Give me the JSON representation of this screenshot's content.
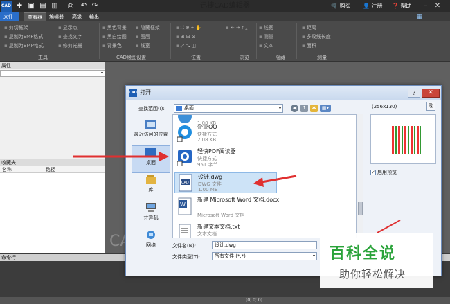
{
  "app": {
    "logo": "CAD",
    "title": "迅捷CAD编辑器",
    "top_right": {
      "buy": "购买",
      "register": "注册",
      "help": "帮助"
    }
  },
  "menu": [
    "文件",
    "查看器",
    "编辑器",
    "高级",
    "输出"
  ],
  "ribbon": {
    "tools": {
      "items": [
        "剪切框架",
        "复制为EMF格式",
        "复制为BMP格式",
        "显示点",
        "查找文字",
        "修剪光栅"
      ],
      "label": "工具"
    },
    "settings": {
      "items": [
        "黑色背景",
        "黑白绘图",
        "背景色",
        "图层",
        "线宽",
        "隐藏框架"
      ],
      "label": "CAD绘图设置"
    },
    "position": {
      "label": "位置"
    },
    "browse": {
      "label": "浏览"
    },
    "hide": {
      "items": [
        "线宽",
        "测量",
        "文本"
      ],
      "label": "隐藏"
    },
    "measure": {
      "items": [
        "距离",
        "多段线长度",
        "面积"
      ],
      "label": "测量"
    }
  },
  "panels": {
    "properties": "属性",
    "favorites": "收藏夹",
    "fav_columns": [
      "名称",
      "路径"
    ],
    "command": "命令行"
  },
  "canvas_text": "CAD",
  "status_text": "(0; 0; 0)",
  "dialog": {
    "title": "打开",
    "help": "?",
    "close": "✕",
    "look_in_label": "查找范围(I):",
    "look_in_value": "桌面",
    "places": [
      "最近访问的位置",
      "桌面",
      "库",
      "计算机",
      "网络"
    ],
    "files": [
      {
        "name": "",
        "type": "",
        "size": "1.00 KB"
      },
      {
        "name": "企业QQ",
        "type": "快捷方式",
        "size": "2.08 KB"
      },
      {
        "name": "轻快PDF阅读器",
        "type": "快捷方式",
        "size": "951 字节"
      },
      {
        "name": "设计.dwg",
        "type": "DWG 文件",
        "size": "1.00 MB"
      },
      {
        "name": "新建 Microsoft Word 文档.docx",
        "type": "Microsoft Word 文档",
        "size": ""
      },
      {
        "name": "新建文本文档.txt",
        "type": "文本文档",
        "size": ""
      }
    ],
    "filename_label": "文件名(N):",
    "filename_value": "设计.dwg",
    "filetype_label": "文件类型(T):",
    "filetype_value": "所有文件 (*.*)",
    "preview_size": "(256x130)",
    "preview_check": "启用预览"
  },
  "watermark": {
    "line1": "百科全说",
    "line2": "助你轻松解决"
  },
  "colors": {
    "accent": "#2a6ec9",
    "arrow": "#e03030",
    "baike_green": "#2aa33a"
  }
}
